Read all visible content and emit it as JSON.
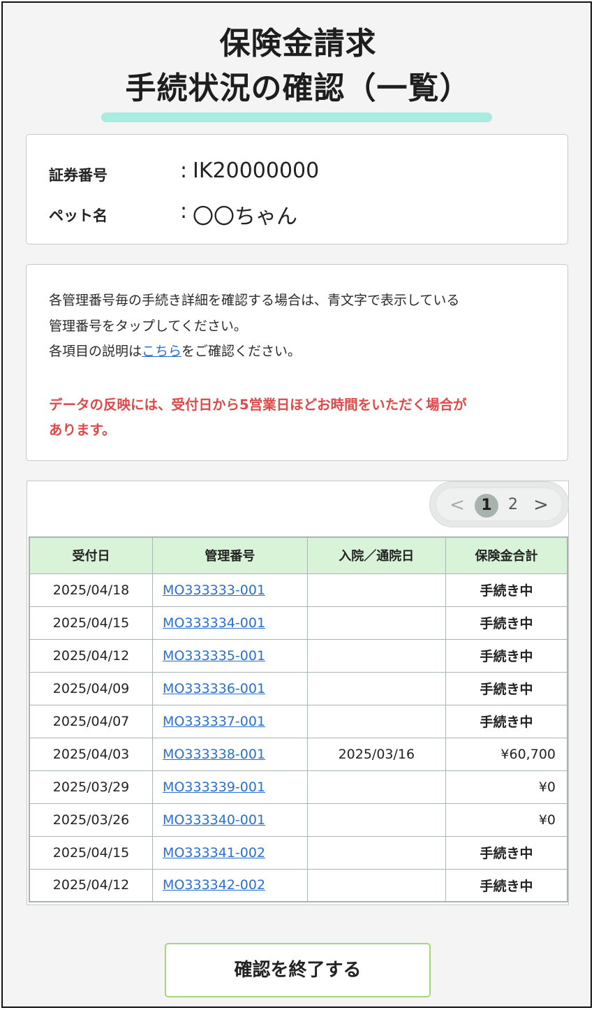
{
  "header": {
    "title_line1": "保険金請求",
    "title_line2": "手続状況の確認（一覧）"
  },
  "policy": {
    "number_label": "証券番号",
    "number_colon": ":",
    "number_value": "IK20000000",
    "pet_label": "ペット名",
    "pet_colon": ":",
    "pet_value": "〇〇ちゃん"
  },
  "notice": {
    "line1": "各管理番号毎の手続き詳細を確認する場合は、青文字で表示している",
    "line2": "管理番号をタップしてください。",
    "line3_prefix": "各項目の説明は",
    "line3_link": "こちら",
    "line3_suffix": "をご確認ください。",
    "warning_line1": "データの反映には、受付日から5営業日ほどお時間をいただく場合が",
    "warning_line2": "あります。"
  },
  "pagination": {
    "prev": "<",
    "current": "1",
    "page2": "2",
    "next": ">"
  },
  "table": {
    "headers": [
      "受付日",
      "管理番号",
      "入院／通院日",
      "保険金合計"
    ],
    "rows": [
      {
        "date": "2025/04/18",
        "number": "MO333333-001",
        "hospital": "",
        "amount": "手続き中"
      },
      {
        "date": "2025/04/15",
        "number": "MO333334-001",
        "hospital": "",
        "amount": "手続き中"
      },
      {
        "date": "2025/04/12",
        "number": "MO333335-001",
        "hospital": "",
        "amount": "手続き中"
      },
      {
        "date": "2025/04/09",
        "number": "MO333336-001",
        "hospital": "",
        "amount": "手続き中"
      },
      {
        "date": "2025/04/07",
        "number": "MO333337-001",
        "hospital": "",
        "amount": "手続き中"
      },
      {
        "date": "2025/04/03",
        "number": "MO333338-001",
        "hospital": "2025/03/16",
        "amount": "¥60,700"
      },
      {
        "date": "2025/03/29",
        "number": "MO333339-001",
        "hospital": "",
        "amount": "¥0"
      },
      {
        "date": "2025/03/26",
        "number": "MO333340-001",
        "hospital": "",
        "amount": "¥0"
      },
      {
        "date": "2025/04/15",
        "number": "MO333341-002",
        "hospital": "",
        "amount": "手続き中"
      },
      {
        "date": "2025/04/12",
        "number": "MO333342-002",
        "hospital": "",
        "amount": "手続き中"
      }
    ]
  },
  "footer": {
    "end_button_label": "確認を終了する"
  },
  "colors": {
    "accent_underline": "#a8ebdf",
    "header_bg": "#d8f3d8",
    "link": "#2a6fd1",
    "warning": "#e04848",
    "button_border": "#a5d77a"
  }
}
